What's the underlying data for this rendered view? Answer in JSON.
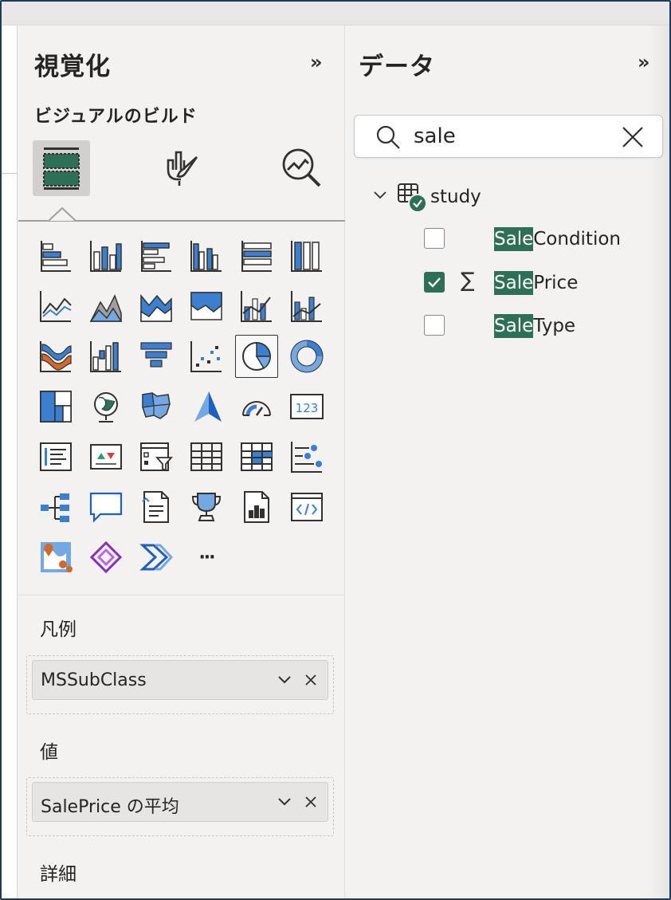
{
  "visualizations": {
    "title": "視覚化",
    "expand_glyph": "»",
    "build_label": "ビジュアルのビルド",
    "more_glyph": "···",
    "wells": [
      {
        "label": "凡例",
        "field": "MSSubClass"
      },
      {
        "label": "値",
        "field": "SalePrice の平均"
      }
    ],
    "details_label": "詳細",
    "selected_visual": "pie-chart"
  },
  "data_pane": {
    "title": "データ",
    "expand_glyph": "»",
    "search": {
      "value": "sale",
      "placeholder": ""
    },
    "table": {
      "name": "study"
    },
    "fields": [
      {
        "match": "Sale",
        "rest": "Condition",
        "checked": false,
        "measure": false
      },
      {
        "match": "Sale",
        "rest": "Price",
        "checked": true,
        "measure": true
      },
      {
        "match": "Sale",
        "rest": "Type",
        "checked": false,
        "measure": false
      }
    ]
  },
  "colors": {
    "accent_green": "#2e6f58",
    "chart_blue": "#3a7fd0",
    "light_blue": "#74a8e3",
    "orange": "#d06a2a",
    "frame": "#1f3a5f"
  }
}
